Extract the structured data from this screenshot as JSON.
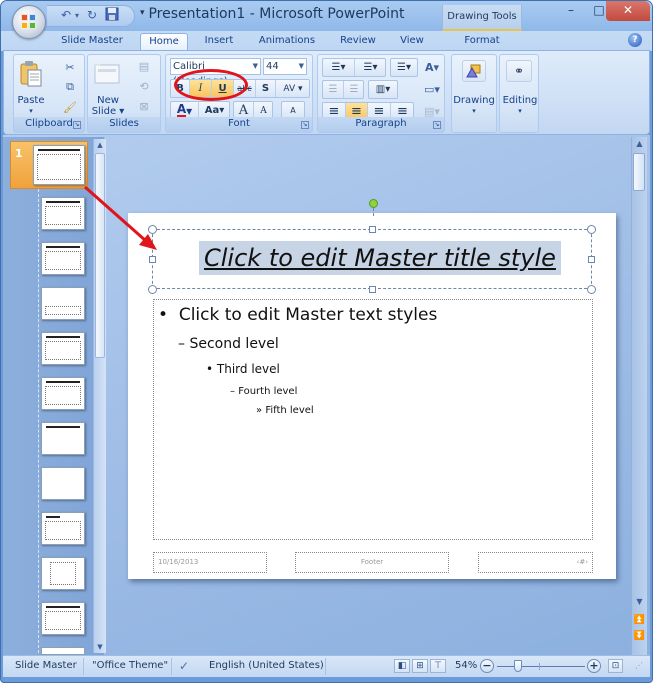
{
  "window": {
    "title": "Presentation1 - Microsoft PowerPoint",
    "contextual_group": "Drawing Tools",
    "controls": {
      "minimize": "–",
      "maximize": "□",
      "close": "✕"
    }
  },
  "qat": {
    "undo_icon": "↶",
    "redo_icon": "↻",
    "save_icon": "💾",
    "customize": "▾"
  },
  "tabs": [
    {
      "label": "Slide Master",
      "active": false
    },
    {
      "label": "Home",
      "active": true
    },
    {
      "label": "Insert",
      "active": false
    },
    {
      "label": "Animations",
      "active": false
    },
    {
      "label": "Review",
      "active": false
    },
    {
      "label": "View",
      "active": false
    },
    {
      "label": "Format",
      "active": false
    }
  ],
  "help": "?",
  "ribbon": {
    "clipboard": {
      "label": "Clipboard",
      "paste": "Paste",
      "paste_dd": "▾",
      "cut": "✂",
      "copy": "⧉",
      "format_painter": "🖌"
    },
    "slides": {
      "label": "Slides",
      "new_slide_line1": "New",
      "new_slide_line2": "Slide ▾"
    },
    "font": {
      "label": "Font",
      "font_name": "Calibri (Headings)",
      "font_size": "44",
      "bold": "B",
      "italic": "I",
      "underline": "U",
      "strikethrough": "abc",
      "shadow": "S",
      "spacing": "AV",
      "font_color": "A",
      "change_case": "Aa",
      "grow": "A",
      "shrink": "A",
      "clear": "A",
      "italic_active": true,
      "underline_active": true
    },
    "paragraph": {
      "label": "Paragraph",
      "bullets": "☰",
      "numbering": "☰",
      "line_spacing": "☰",
      "text_direction": "A",
      "decrease_indent": "☰",
      "increase_indent": "☰",
      "columns": "▥",
      "align_left": "≡",
      "align_center": "≡",
      "align_right": "≡",
      "justify": "≡",
      "center_active": true
    },
    "drawing": {
      "label": "Drawing",
      "dd": "▾"
    },
    "editing": {
      "label": "Editing",
      "dd": "▾"
    }
  },
  "thumbnails": {
    "selected_number": "1",
    "count_visible": 11
  },
  "slide": {
    "title": "Click to edit Master title style",
    "levels": [
      {
        "bullet": "•",
        "text": "Click to edit Master text styles"
      },
      {
        "bullet": "–",
        "text": "Second level"
      },
      {
        "bullet": "•",
        "text": "Third level"
      },
      {
        "bullet": "–",
        "text": "Fourth level"
      },
      {
        "bullet": "»",
        "text": "Fifth level"
      }
    ],
    "footer_date": "10/16/2013",
    "footer_text": "Footer",
    "footer_number": "‹#›"
  },
  "statusbar": {
    "view": "Slide Master",
    "theme": "\"Office Theme\"",
    "language": "English (United States)",
    "zoom": "54%",
    "zoom_percent": 54,
    "zoom_out": "−",
    "zoom_in": "+",
    "fit": "⊡"
  },
  "colors": {
    "annotation_red": "#e0141a",
    "active_button": "#fbc45e",
    "selected_thumb": "#f0a23c"
  }
}
